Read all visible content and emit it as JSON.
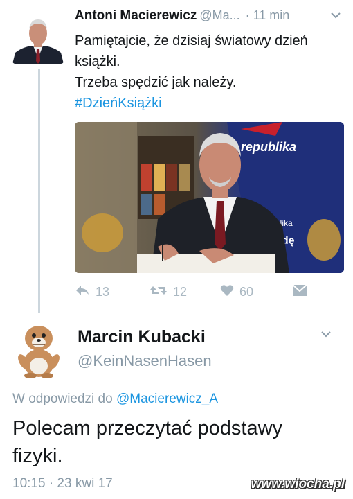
{
  "tweet1": {
    "name": "Antoni Macierewicz",
    "handle": "@Ma...",
    "time": "· 11 min",
    "text_lines": [
      "Pamiętajcie, że dzisiaj światowy dzień",
      "książki.",
      "Trzeba spędzić jak należy."
    ],
    "hashtag": "#DzieńKsiążki",
    "image": {
      "banner_text": "republika",
      "banner_side_1": "blika",
      "banner_side_2": "vdę"
    },
    "actions": {
      "replies": "13",
      "retweets": "12",
      "likes": "60"
    },
    "icons": [
      "reply-icon",
      "retweet-icon",
      "heart-icon",
      "dm-icon",
      "chevron-down-icon"
    ]
  },
  "tweet2": {
    "name": "Marcin Kubacki",
    "handle": "@KeinNasenHasen",
    "reply_prefix": "W odpowiedzi do",
    "reply_mention": "@Macierewicz_A",
    "text_lines": [
      "Polecam przeczytać podstawy",
      "fizyki."
    ],
    "timestamp": "10:15 · 23 kwi 17"
  },
  "watermark": "www.wiocha.pl",
  "colors": {
    "link": "#1b95e0",
    "muted": "#8899a6",
    "icon": "#aab8c2",
    "text": "#14171a",
    "thread_line": "#ccd6dd"
  }
}
